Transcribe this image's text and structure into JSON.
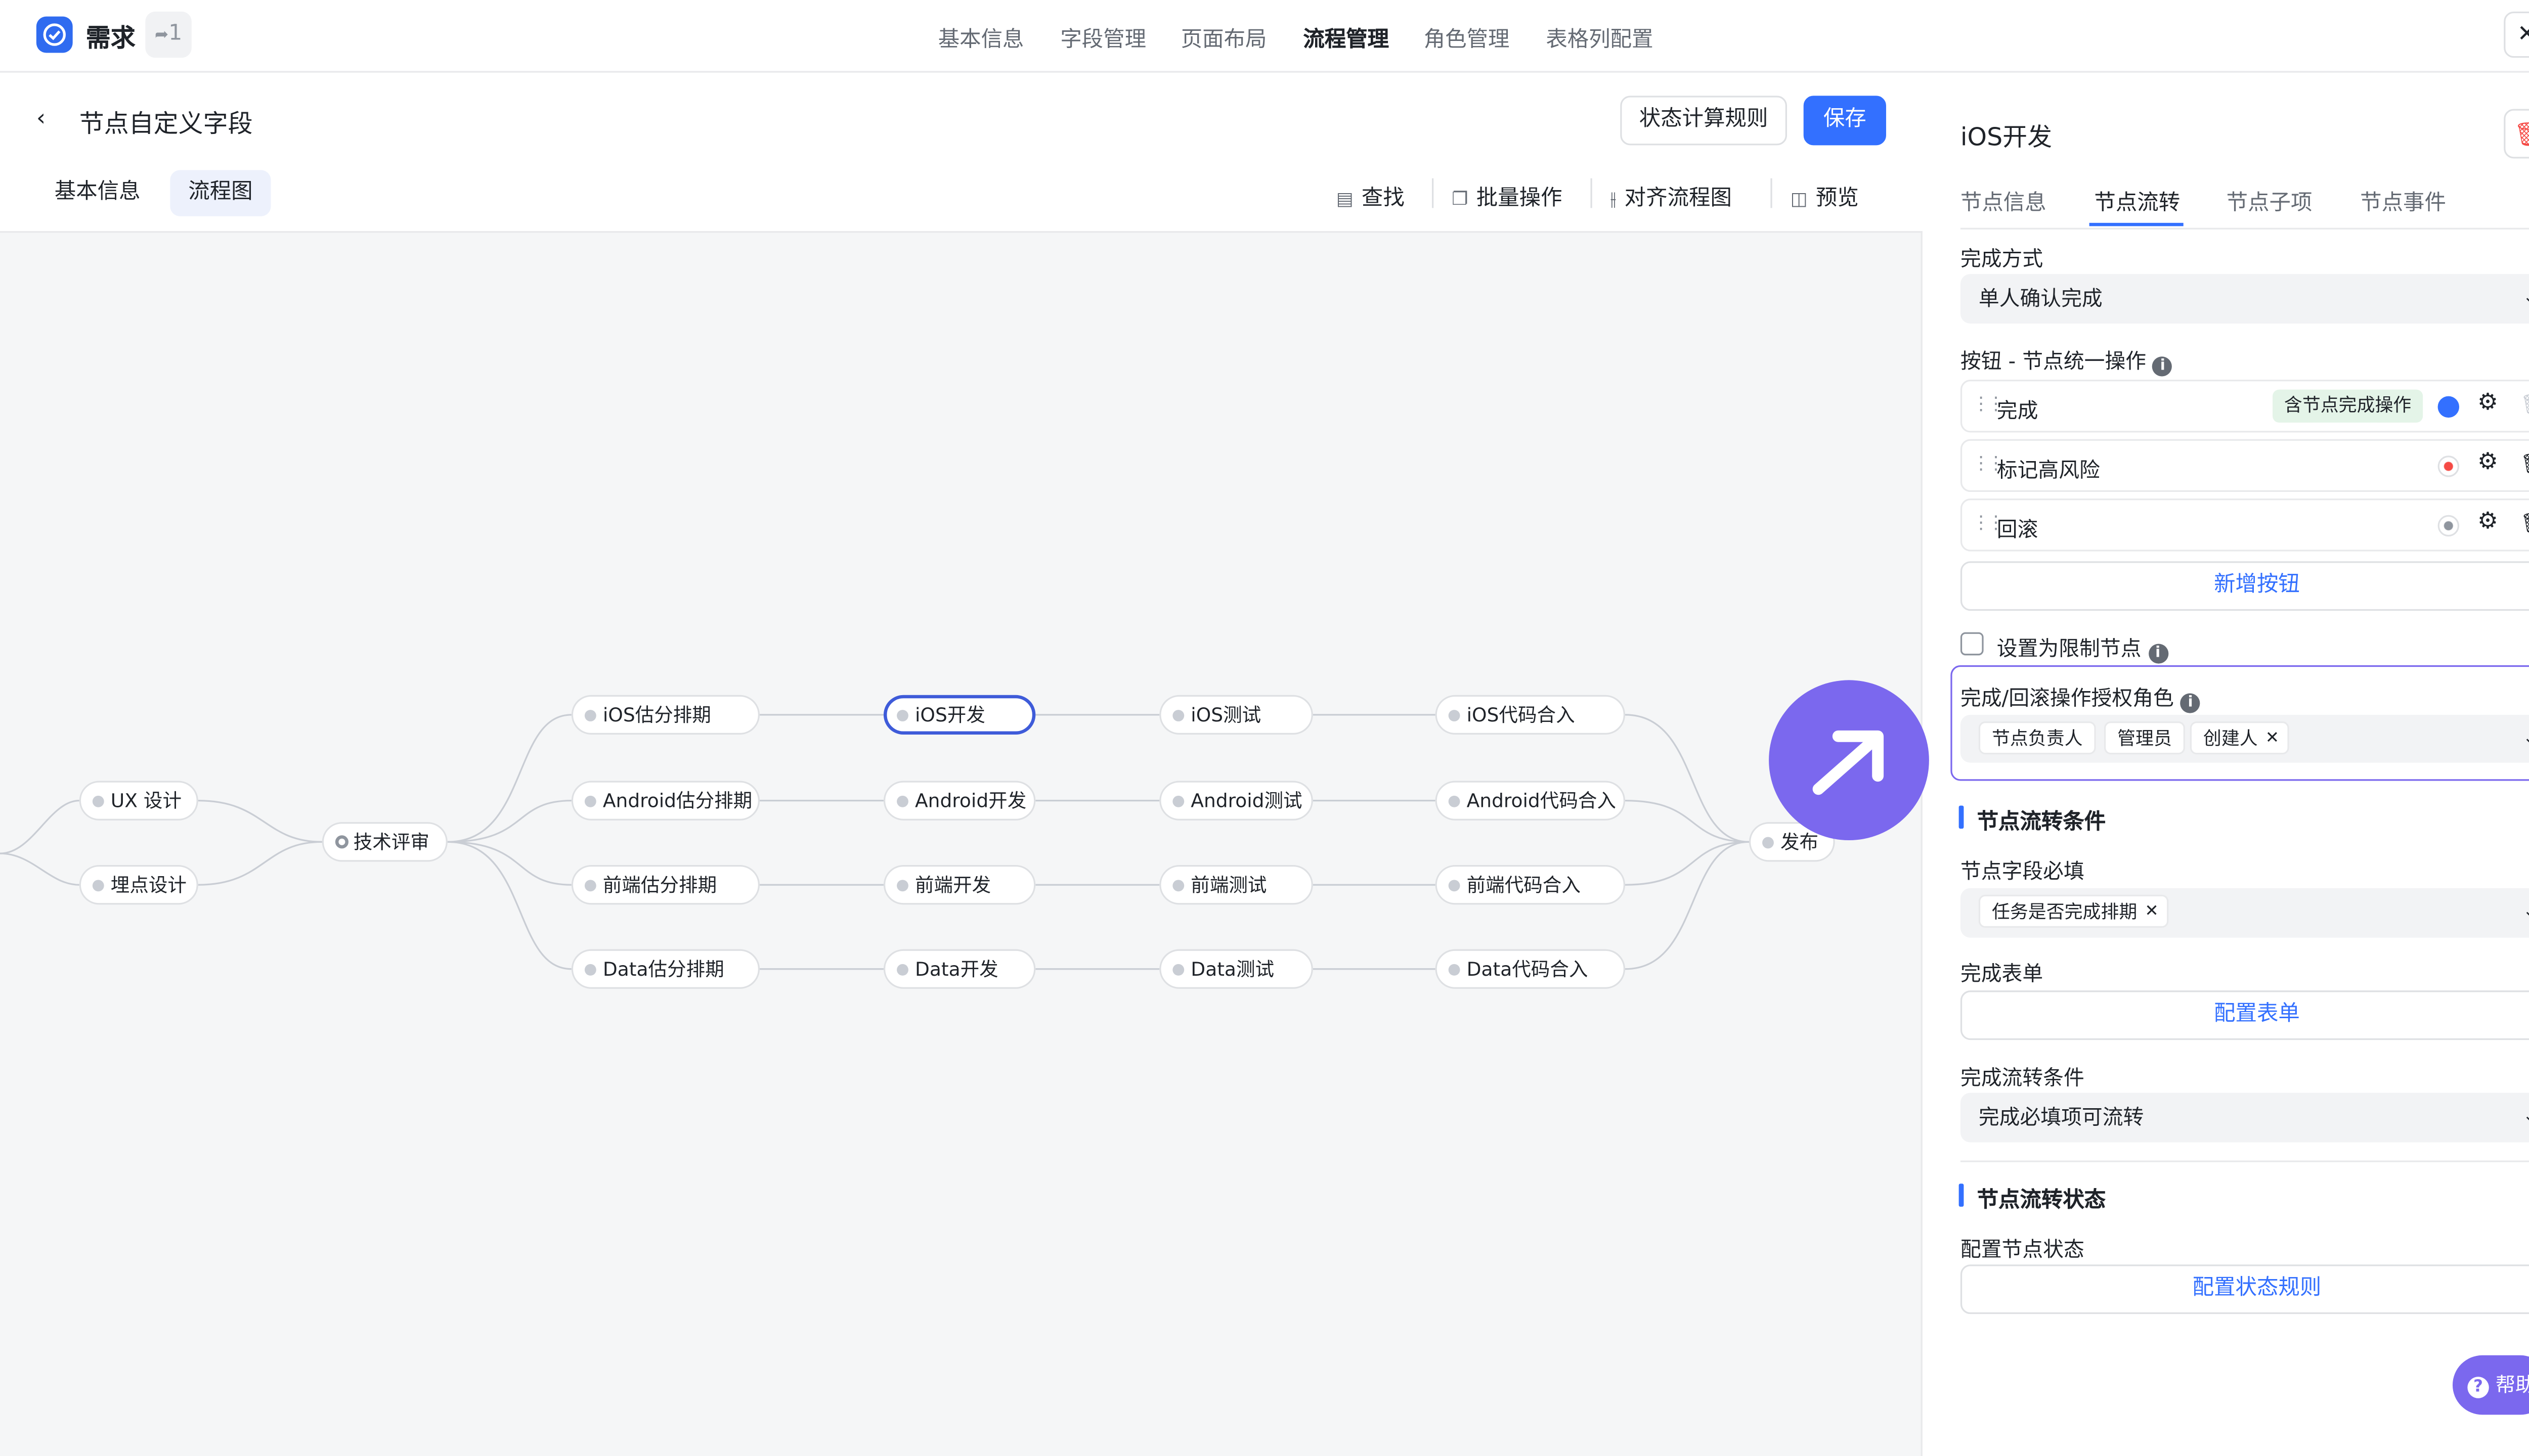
{
  "app": {
    "title": "需求",
    "badge": "1"
  },
  "top_nav": {
    "tabs": [
      {
        "label": "基本信息"
      },
      {
        "label": "字段管理"
      },
      {
        "label": "页面布局"
      },
      {
        "label": "流程管理",
        "active": true
      },
      {
        "label": "角色管理"
      },
      {
        "label": "表格列配置"
      }
    ]
  },
  "page": {
    "title": "节点自定义字段",
    "status_rule_button": "状态计算规则",
    "save_button": "保存",
    "subtabs": [
      {
        "label": "基本信息"
      },
      {
        "label": "流程图",
        "active": true
      }
    ],
    "toolbar": {
      "find": "查找",
      "batch": "批量操作",
      "align": "对齐流程图",
      "preview": "预览"
    }
  },
  "flow": {
    "nodes": {
      "ux": "UX 设计",
      "tracking": "埋点设计",
      "review": "技术评审",
      "ios_est": "iOS估分排期",
      "android_est": "Android估分排期",
      "fe_est": "前端估分排期",
      "data_est": "Data估分排期",
      "ios_dev": "iOS开发",
      "android_dev": "Android开发",
      "fe_dev": "前端开发",
      "data_dev": "Data开发",
      "ios_test": "iOS测试",
      "android_test": "Android测试",
      "fe_test": "前端测试",
      "data_test": "Data测试",
      "ios_merge": "iOS代码合入",
      "android_merge": "Android代码合入",
      "fe_merge": "前端代码合入",
      "data_merge": "Data代码合入",
      "release": "发布"
    },
    "selected": "ios_dev"
  },
  "panel": {
    "title": "iOS开发",
    "tabs": [
      {
        "label": "节点信息"
      },
      {
        "label": "节点流转",
        "active": true
      },
      {
        "label": "节点子项"
      },
      {
        "label": "节点事件"
      }
    ],
    "completion_mode_label": "完成方式",
    "completion_mode_value": "单人确认完成",
    "buttons_label": "按钮 - 节点统一操作",
    "buttons": [
      {
        "label": "完成",
        "tag": "含节点完成操作"
      },
      {
        "label": "标记高风险"
      },
      {
        "label": "回滚"
      }
    ],
    "add_button": "新增按钮",
    "limit_node_label": "设置为限制节点",
    "roles_label": "完成/回滚操作授权角色",
    "roles": [
      "节点负责人",
      "管理员",
      "创建人"
    ],
    "flow_conditions_title": "节点流转条件",
    "required_fields_label": "节点字段必填",
    "required_fields": [
      "任务是否完成排期"
    ],
    "form_label": "完成表单",
    "form_button": "配置表单",
    "flow_condition_label": "完成流转条件",
    "flow_condition_value": "完成必填项可流转",
    "flow_status_title": "节点流转状态",
    "status_config_label": "配置节点状态",
    "status_config_button": "配置状态规则",
    "help": "帮助"
  },
  "colors": {
    "primary": "#3370ff",
    "accent": "#7b68ee",
    "danger": "#f54a45"
  }
}
